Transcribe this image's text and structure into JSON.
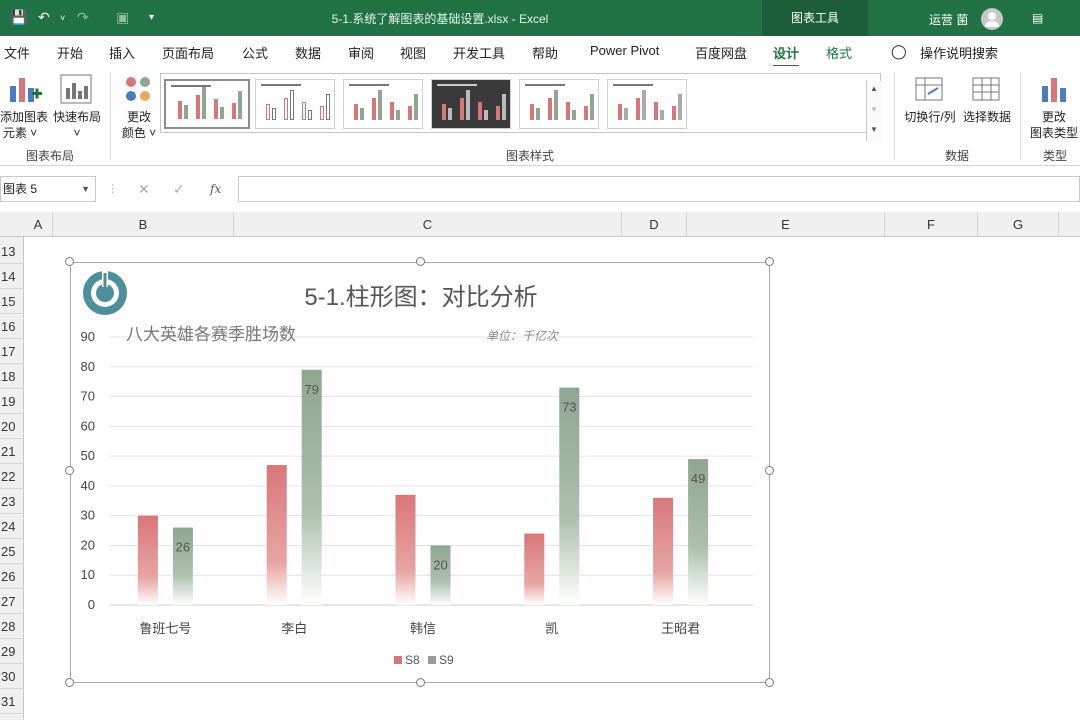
{
  "titlebar": {
    "title": "5-1.系统了解图表的基础设置.xlsx  -  Excel",
    "context_tool": "图表工具",
    "user": "运营 菌"
  },
  "ribbon_tabs": [
    "文件",
    "开始",
    "插入",
    "页面布局",
    "公式",
    "数据",
    "审阅",
    "视图",
    "开发工具",
    "帮助",
    "Power Pivot",
    "百度网盘",
    "设计",
    "格式",
    "操作说明搜索"
  ],
  "ribbon": {
    "add_element": "添加图表元素",
    "add_element_l1": "添加图表",
    "add_element_l2": "元素 ˅",
    "quick_layout": "快速布局",
    "change_color_l1": "更改",
    "change_color_l2": "颜色 ˅",
    "group_layout": "图表布局",
    "group_styles": "图表样式",
    "switch_rowcol": "切换行/列",
    "select_data": "选择数据",
    "group_data": "数据",
    "change_type_l1": "更改",
    "change_type_l2": "图表类型",
    "group_type": "类型"
  },
  "formula_bar": {
    "name_box": "图表 5",
    "fx": "fx",
    "value": ""
  },
  "columns": [
    "A",
    "B",
    "C",
    "D",
    "E",
    "F",
    "G"
  ],
  "rows": [
    "13",
    "14",
    "15",
    "16",
    "17",
    "18",
    "19",
    "20",
    "21",
    "22",
    "23",
    "24",
    "25",
    "26",
    "27",
    "28",
    "29",
    "30",
    "31"
  ],
  "colors": {
    "excel_green": "#217346",
    "s8": "#d9767a",
    "s9": "#8fa692"
  },
  "chart_data": {
    "type": "bar",
    "title": "5-1.柱形图：对比分析",
    "subtitle": "八大英雄各赛季胜场数",
    "unit_note": "单位：千亿次",
    "categories": [
      "鲁班七号",
      "李白",
      "韩信",
      "凯",
      "王昭君"
    ],
    "series": [
      {
        "name": "S8",
        "values": [
          30,
          47,
          37,
          24,
          36
        ],
        "labels": false
      },
      {
        "name": "S9",
        "values": [
          26,
          79,
          20,
          73,
          49
        ],
        "labels": true
      }
    ],
    "ylim": [
      0,
      90
    ],
    "yticks": [
      "0",
      "10",
      "20",
      "30",
      "40",
      "50",
      "60",
      "70",
      "80",
      "90"
    ],
    "grid": true,
    "legend": "bottom"
  }
}
